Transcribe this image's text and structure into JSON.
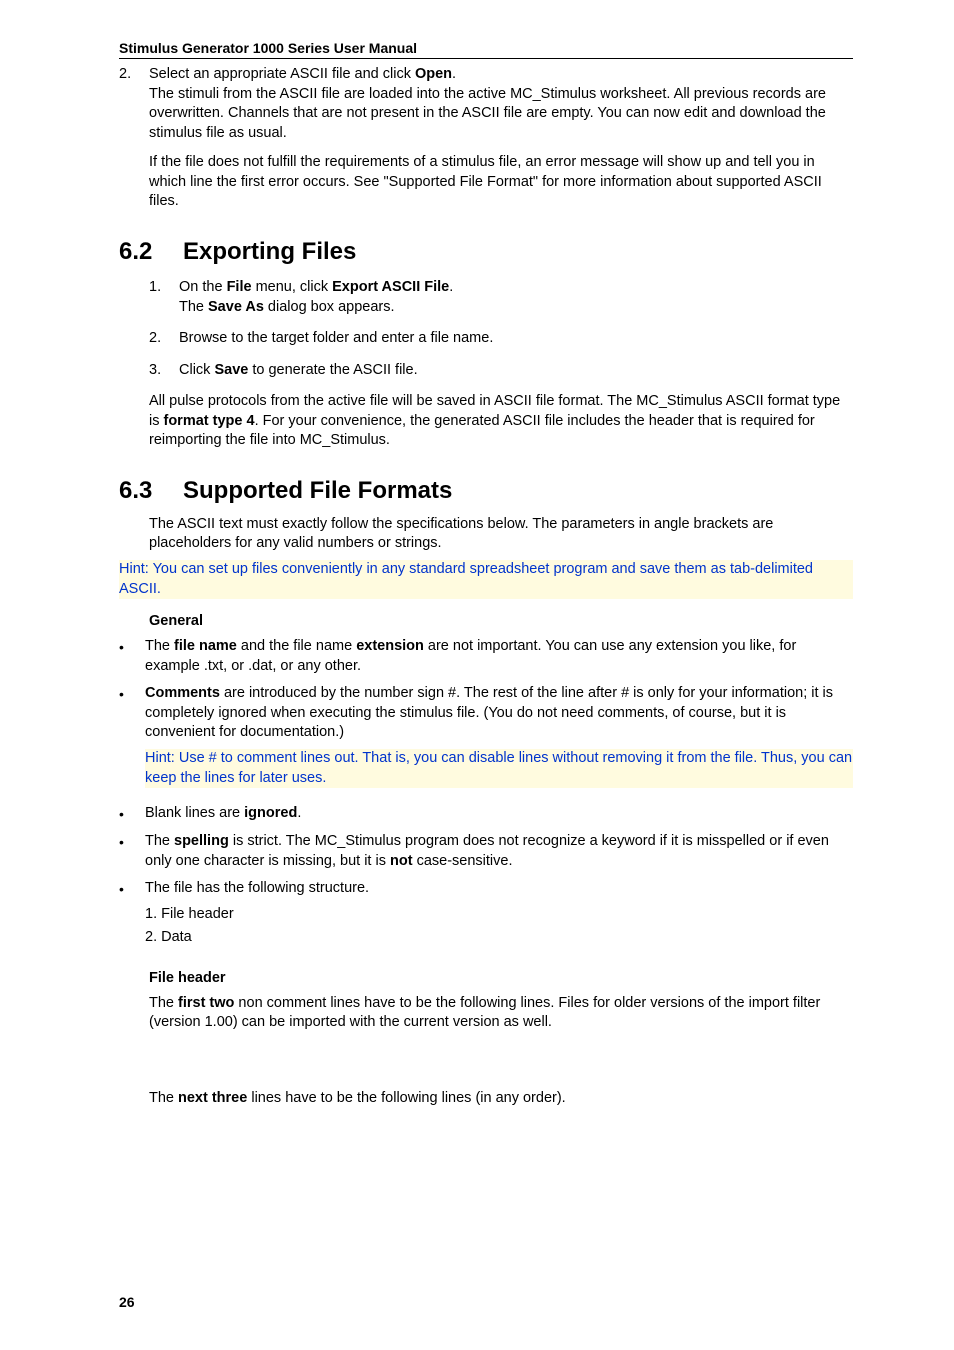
{
  "header": {
    "title": "Stimulus Generator 1000 Series User Manual"
  },
  "step2": {
    "num": "2.",
    "line1_a": "Select an appropriate ASCII file and click ",
    "open": "Open",
    "line1_b": ".",
    "line2": "The stimuli from the ASCII file are loaded into the active MC_Stimulus worksheet. All previous records are overwritten. Channels that are not present in the ASCII file are empty. You can now edit and download the stimulus file as usual.",
    "line3": "If the file does not fulfill the requirements of a stimulus file, an error message will show up and tell you in which line the first error occurs. See \"Supported File Format\" for more information about supported ASCII files."
  },
  "sec62": {
    "num": "6.2",
    "title": "Exporting Files",
    "s1": {
      "num": "1.",
      "txta": "On the ",
      "file": "File",
      "txtb": " menu, click ",
      "export": "Export ASCII File",
      "txtc": ".",
      "line2a": "The ",
      "saveas": "Save As",
      "line2b": " dialog box appears."
    },
    "s2": {
      "num": "2.",
      "txt": "Browse to the target folder and enter a file name."
    },
    "s3": {
      "num": "3.",
      "txta": "Click ",
      "save": "Save",
      "txtb": " to generate the ASCII file."
    },
    "paraA": "All pulse protocols from the active file will be saved in ASCII file format. The MC_Stimulus ASCII format type is ",
    "ft4": "format type 4",
    "paraB": ". For your convenience, the generated ASCII file includes the header that is required for reimporting the file into MC_Stimulus."
  },
  "sec63": {
    "num": "6.3",
    "title": "Supported File Formats",
    "intro": "The ASCII text must exactly follow the specifications below. The parameters in angle brackets are placeholders for any valid numbers or strings.",
    "hint1": "Hint: You can set up files conveniently in any standard spreadsheet program and save them as tab-delimited ASCII.",
    "general": "General",
    "b1a": "The ",
    "b1_fn": "file name",
    "b1b": " and the file name ",
    "b1_ext": "extension",
    "b1c": " are not important. You can use any extension you like, for example .txt, or .dat, or any other.",
    "b2_comments": "Comments",
    "b2b": " are introduced by the number sign #. The rest of the line after # is only for your information; it is completely ignored when executing the stimulus file. (You do not need comments, of course, but it is convenient for documentation.)",
    "hint2": "Hint: Use # to comment lines out. That is, you can disable lines without removing it from the file. Thus, you can keep the lines for later uses.",
    "b3a": "Blank lines are ",
    "b3_ign": "ignored",
    "b3b": ".",
    "b4a": "The ",
    "b4_sp": "spelling",
    "b4b": " is strict. The MC_Stimulus program does not recognize a keyword if it is misspelled or if even only one character is missing, but it is ",
    "b4_not": "not",
    "b4c": " case-sensitive.",
    "b5": "The file has the following structure.",
    "b5s1": "1. File header",
    "b5s2": "2. Data",
    "fh_heading": "File header",
    "fh1a": "The ",
    "fh1_first": "first two",
    "fh1b": " non comment lines have to be the following lines. Files for older versions of the import filter (version 1.00) can be imported with the current version as well.",
    "fh2a": "The ",
    "fh2_next": "next three",
    "fh2b": " lines have to be the following lines (in any order)."
  },
  "pagenum": "26"
}
